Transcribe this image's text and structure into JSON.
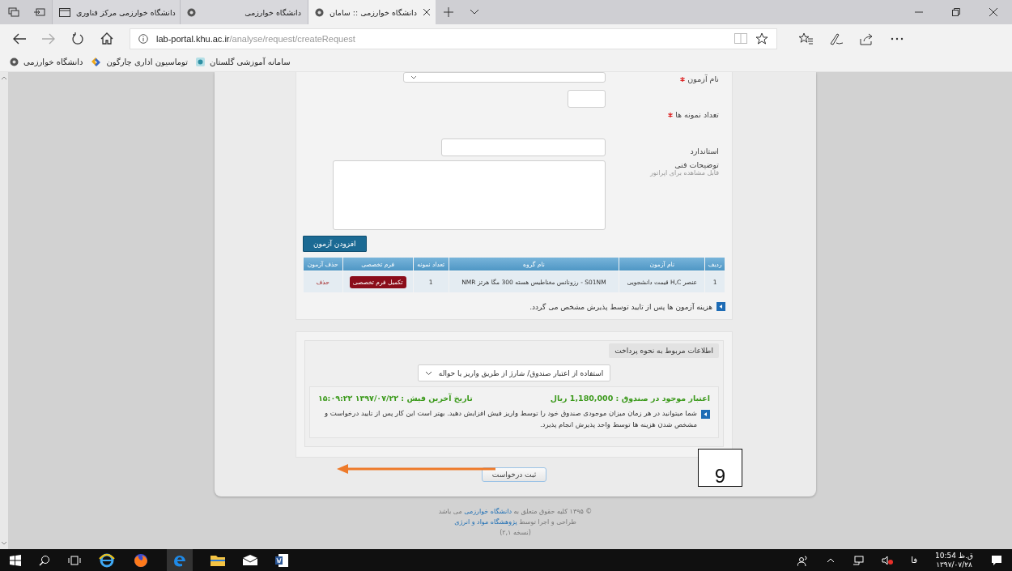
{
  "browser": {
    "tabs": [
      {
        "title": "دانشگاه خوارزمی :: سامان",
        "selected": true
      },
      {
        "title": "دانشگاه خوارزمی",
        "selected": false
      },
      {
        "title": "دانشگاه خوارزمی مرکز فناوری",
        "selected": false
      }
    ],
    "address": {
      "host": "lab-portal.khu.ac.ir",
      "path": "/analyse/request/createRequest"
    },
    "bookmarks": [
      {
        "title": "سامانه آموزشی گلستان",
        "kind": "badge"
      },
      {
        "title": "توماسیون اداری چارگون",
        "kind": "swirl"
      },
      {
        "title": "دانشگاه خوارزمی",
        "kind": "seal"
      }
    ]
  },
  "form": {
    "fields": [
      {
        "kind": "select",
        "label": "نام آزمون",
        "required": true
      },
      {
        "kind": "number",
        "label": "تعداد نمونه ها",
        "required": true
      },
      {
        "kind": "text",
        "label": "استاندارد",
        "required": false
      },
      {
        "kind": "textarea",
        "label": "توضیحات فنی",
        "hint": "قابل مشاهده برای اپراتور",
        "required": false
      }
    ],
    "add_button": "افزودن آزمون",
    "table": {
      "columns": [
        "ردیف",
        "نام آزمون",
        "نام گروه",
        "تعداد نمونه",
        "فرم تخصصی",
        "حذف آزمون"
      ],
      "rows": [
        {
          "row_number": "1",
          "test_name": "عنصر H,C قیمت دانشجویی",
          "group_name": "S01NM - رزونانس مغناطیس هسته 300 مگا هرتز NMR",
          "sample_count": "1",
          "form_button": "تکمیل فرم تخصصی",
          "delete_link": "حذف"
        }
      ]
    },
    "note": "هزینه آزمون ها پس از تایید توسط پذیرش مشخص می گردد."
  },
  "payment": {
    "legend": "اطلاعات مربوط به نحوه پرداخت",
    "method": "استفاده از اعتبار صندوق/ شارژ از طریق واریز یا حواله",
    "balance": "اعتبار موجود در صندوق : 1,180,000 ریال",
    "last_receipt": "تاریخ آخرین فیش : ۱۳۹۷/۰۷/۲۲ ۱۵:۰۹:۲۲",
    "info": "شما میتوانید در هر زمان میزان موجودی صندوق خود را توسط واریز فیش افزایش دهید. بهتر است این کار پس از تایید درخواست و مشخص شدن هزینه ها توسط واحد پذیرش انجام پذیرد."
  },
  "submit_button": "ثبت درخواست",
  "callout": "9",
  "footer": [
    {
      "before": "© ۱۳۹۵ کلیه حقوق متعلق به",
      "link": "دانشگاه خوارزمی",
      "after": "می باشد"
    },
    {
      "before": "طراحی و اجرا توسط",
      "link": "پژوهشگاه مواد و انرژی"
    },
    {
      "before": "(نسخه ۲,۱)"
    }
  ],
  "taskbar": {
    "language": "فا",
    "time": "10:54 ق.ظ",
    "date": "۱۳۹۷/۰۷/۲۸"
  }
}
